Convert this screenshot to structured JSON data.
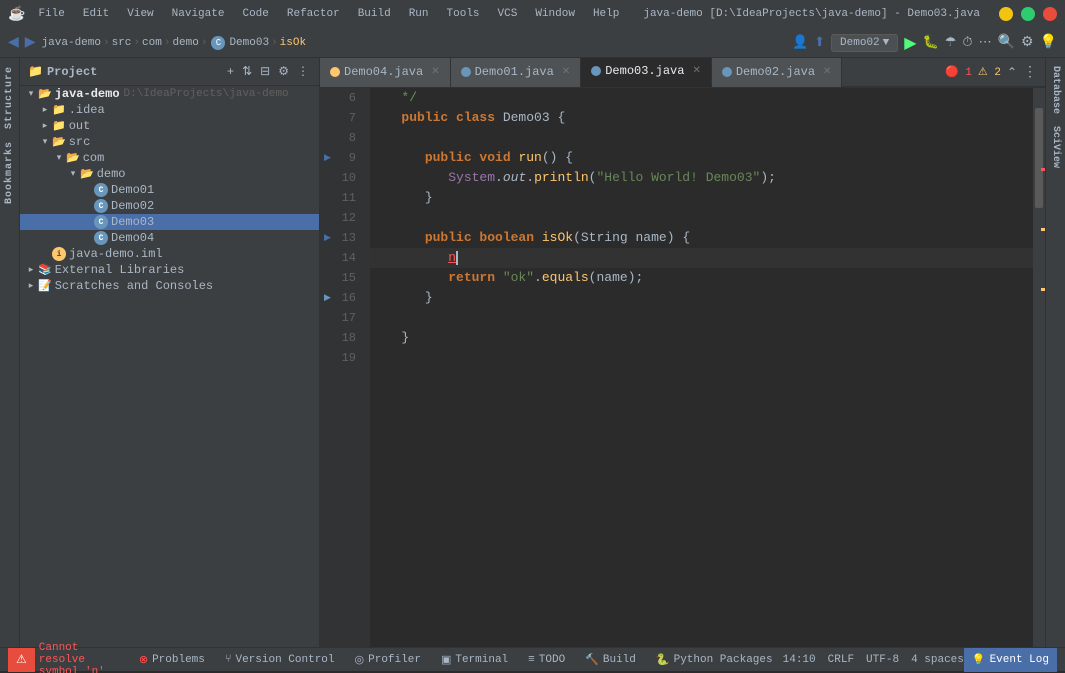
{
  "window": {
    "title": "java-demo [D:\\IdeaProjects\\java-demo] - Demo03.java",
    "icon": "☕"
  },
  "menu": {
    "items": [
      "File",
      "Edit",
      "View",
      "Navigate",
      "Code",
      "Refactor",
      "Build",
      "Run",
      "Tools",
      "VCS",
      "Window",
      "Help"
    ]
  },
  "breadcrumb": {
    "project": "java-demo",
    "src": "src",
    "com": "com",
    "demo": "demo",
    "class": "Demo03",
    "method": "isOk"
  },
  "run_config": {
    "label": "Demo02",
    "dropdown": "▼"
  },
  "sidebar": {
    "title": "Project",
    "items": [
      {
        "label": "java-demo",
        "path": "D:\\IdeaProjects\\java-demo",
        "type": "root",
        "expanded": true,
        "indent": 0
      },
      {
        "label": ".idea",
        "type": "folder",
        "expanded": false,
        "indent": 1
      },
      {
        "label": "out",
        "type": "folder",
        "expanded": false,
        "indent": 1,
        "selected_parent": false
      },
      {
        "label": "src",
        "type": "folder",
        "expanded": true,
        "indent": 1
      },
      {
        "label": "com",
        "type": "folder",
        "expanded": true,
        "indent": 2
      },
      {
        "label": "demo",
        "type": "folder",
        "expanded": true,
        "indent": 3
      },
      {
        "label": "Demo01",
        "type": "class",
        "indent": 4
      },
      {
        "label": "Demo02",
        "type": "class",
        "indent": 4
      },
      {
        "label": "Demo03",
        "type": "class",
        "indent": 4,
        "selected": true
      },
      {
        "label": "Demo04",
        "type": "class",
        "indent": 4
      },
      {
        "label": "java-demo.iml",
        "type": "iml",
        "indent": 1
      },
      {
        "label": "External Libraries",
        "type": "lib",
        "expanded": false,
        "indent": 0
      },
      {
        "label": "Scratches and Consoles",
        "type": "scratches",
        "expanded": false,
        "indent": 0
      }
    ]
  },
  "tabs": [
    {
      "label": "Demo04.java",
      "active": false,
      "color": "orange"
    },
    {
      "label": "Demo01.java",
      "active": false,
      "color": "blue"
    },
    {
      "label": "Demo03.java",
      "active": true,
      "color": "blue"
    },
    {
      "label": "Demo02.java",
      "active": false,
      "color": "blue"
    }
  ],
  "error_indicator": {
    "errors": "1",
    "warnings": "2",
    "error_icon": "🔴",
    "warn_icon": "⚠"
  },
  "code": {
    "lines": [
      {
        "num": "6",
        "content": "   */",
        "type": "comment"
      },
      {
        "num": "7",
        "content": "   public class Demo03 {",
        "type": "code"
      },
      {
        "num": "8",
        "content": "",
        "type": "blank"
      },
      {
        "num": "9",
        "content": "      public void run() {",
        "type": "code",
        "has_arrow": true
      },
      {
        "num": "10",
        "content": "         System.out.println(\"Hello World! Demo03\");",
        "type": "code"
      },
      {
        "num": "11",
        "content": "      }",
        "type": "code"
      },
      {
        "num": "12",
        "content": "",
        "type": "blank"
      },
      {
        "num": "13",
        "content": "      public boolean isOk(String name) {",
        "type": "code",
        "has_arrow": true
      },
      {
        "num": "14",
        "content": "         n",
        "type": "code_cursor"
      },
      {
        "num": "15",
        "content": "         return \"ok\".equals(name);",
        "type": "code"
      },
      {
        "num": "16",
        "content": "      }",
        "type": "code",
        "has_arrow2": true
      },
      {
        "num": "17",
        "content": "",
        "type": "blank"
      },
      {
        "num": "18",
        "content": "   }",
        "type": "code"
      },
      {
        "num": "19",
        "content": "",
        "type": "blank"
      }
    ]
  },
  "status_bar": {
    "error_msg": "Cannot resolve symbol 'n'",
    "position": "14:10",
    "line_ending": "CRLF",
    "encoding": "UTF-8",
    "indent": "4 spaces",
    "bottom_tabs": [
      {
        "label": "Problems",
        "icon": "⚠",
        "active": false
      },
      {
        "label": "Version Control",
        "icon": "⑂",
        "active": false
      },
      {
        "label": "Profiler",
        "icon": "◎",
        "active": false
      },
      {
        "label": "Terminal",
        "icon": "▣",
        "active": false
      },
      {
        "label": "TODO",
        "icon": "≡",
        "active": false
      },
      {
        "label": "Build",
        "icon": "🔨",
        "active": false
      },
      {
        "label": "Python Packages",
        "icon": "🐍",
        "active": false
      }
    ],
    "event_log": "Event Log"
  }
}
